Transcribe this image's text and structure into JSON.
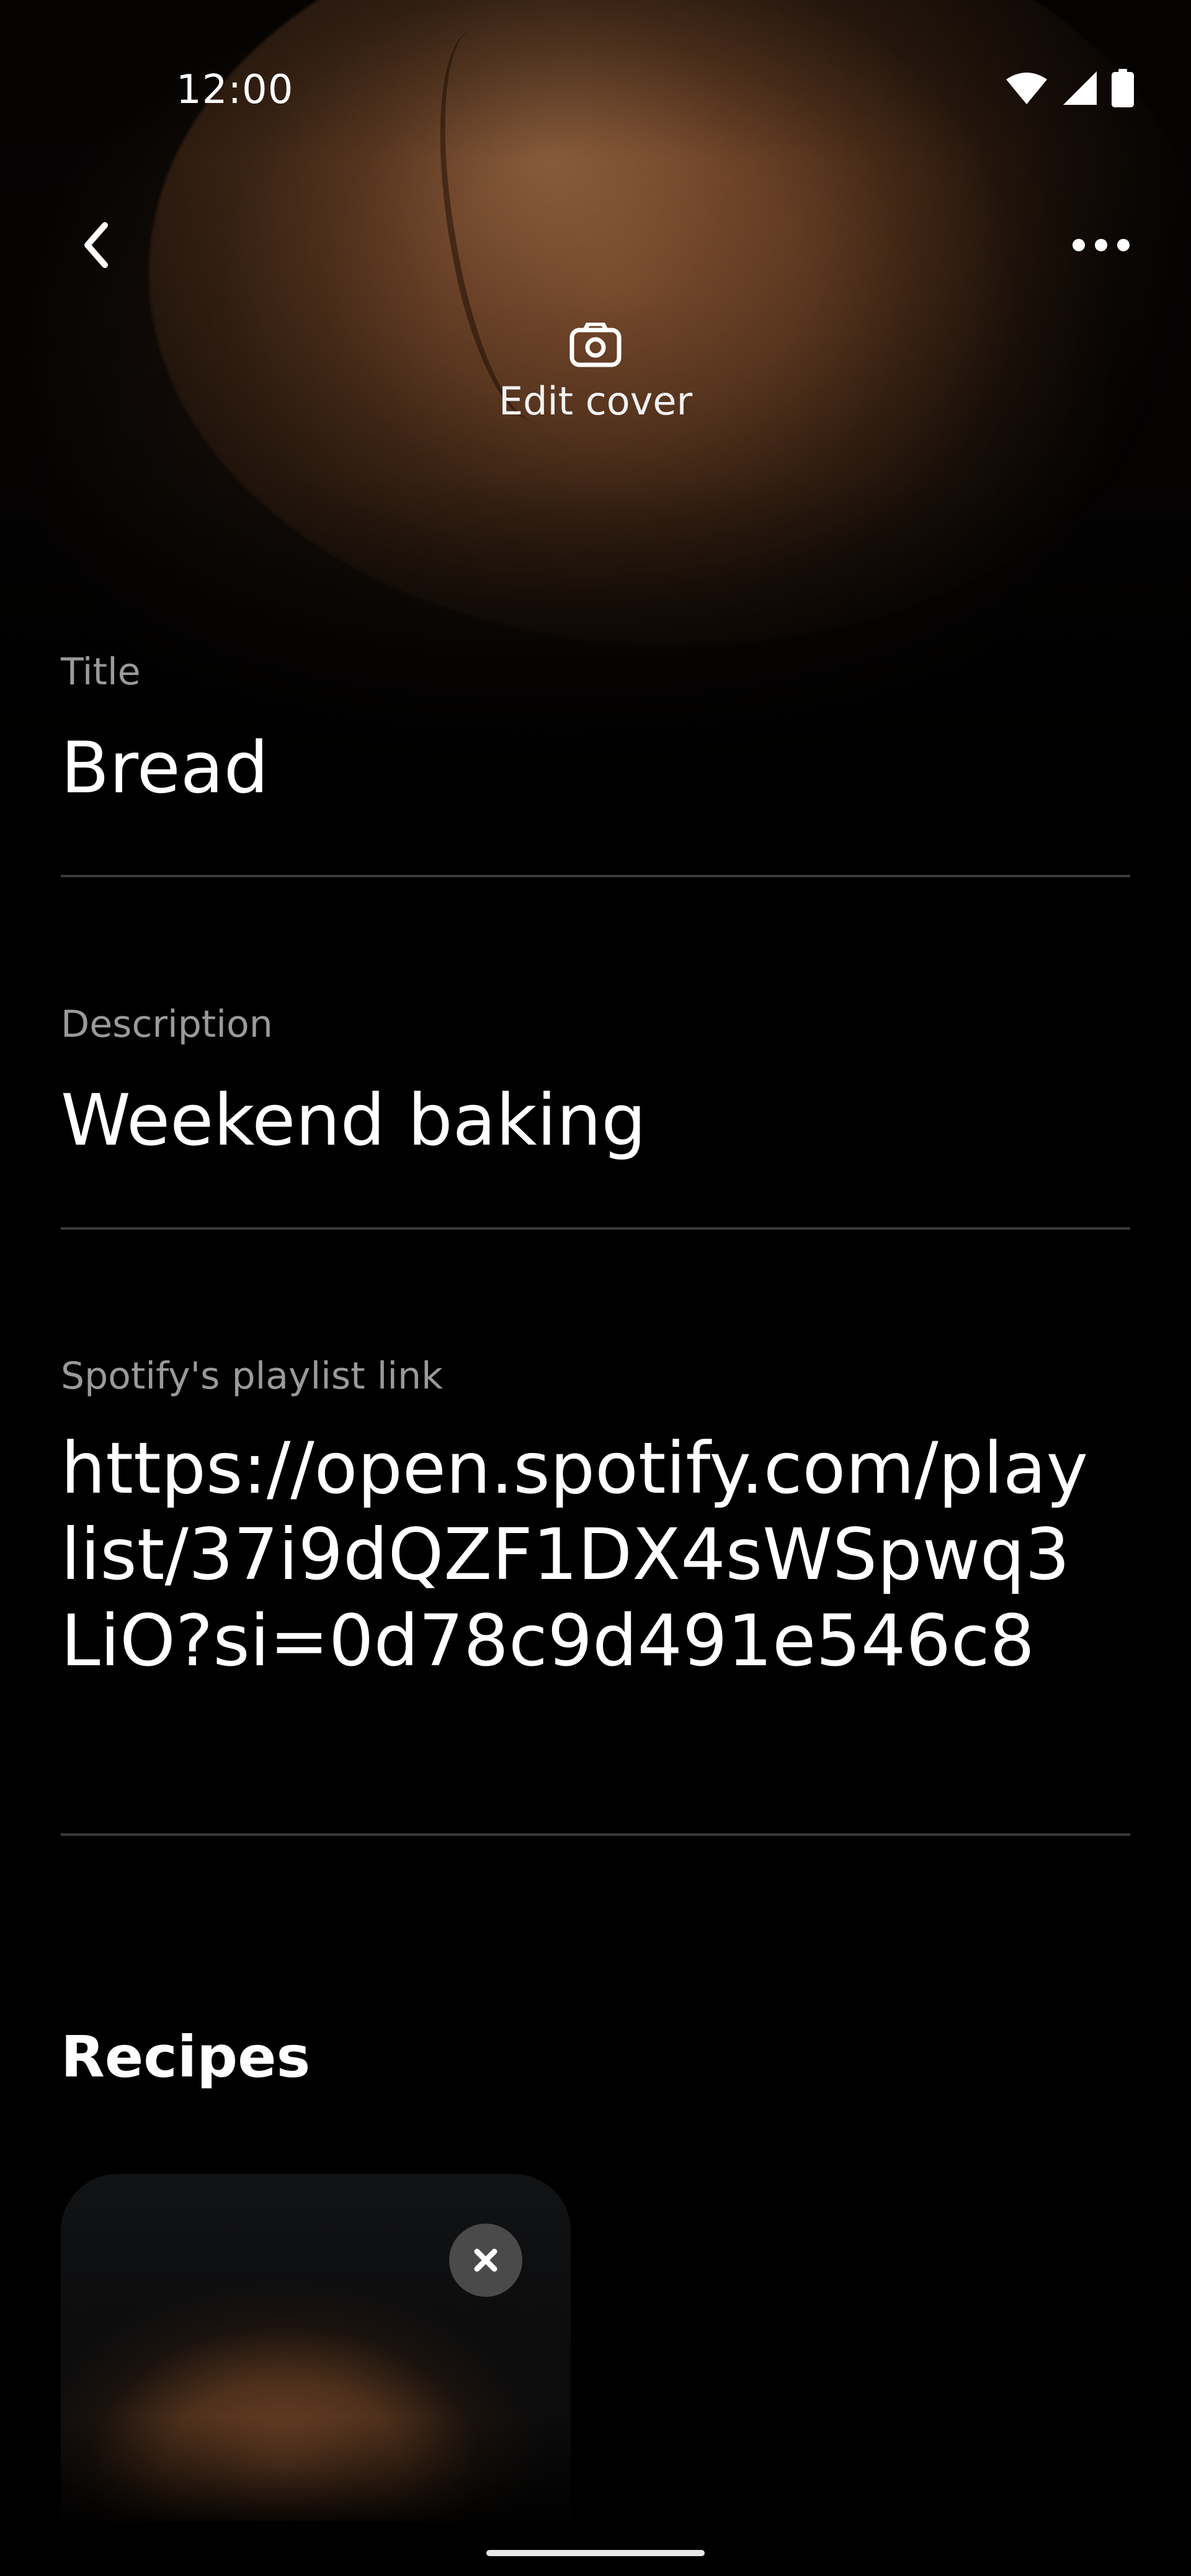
{
  "status_bar": {
    "time": "12:00",
    "icons": [
      "wifi-icon",
      "cellular-signal-icon",
      "battery-icon"
    ]
  },
  "app_bar": {
    "back_icon": "chevron-left-icon",
    "more_icon": "more-horizontal-icon"
  },
  "cover": {
    "edit_icon": "camera-icon",
    "edit_label": "Edit cover"
  },
  "form": {
    "title": {
      "label": "Title",
      "value": "Bread"
    },
    "description": {
      "label": "Description",
      "value": "Weekend baking"
    },
    "playlist": {
      "label": "Spotify's playlist link",
      "value": "https://open.spotify.com/playlist/37i9dQZF1DX4sWSpwq3LiO?si=0d78c9d491e546c8"
    }
  },
  "recipes": {
    "heading": "Recipes",
    "items": [
      {
        "remove_icon": "close-icon"
      }
    ]
  },
  "colors": {
    "background": "#000000",
    "label": "#9a9a9a",
    "divider": "#3a3a3a",
    "card": "#0e0f10",
    "remove_button": "#4a4a4a"
  }
}
